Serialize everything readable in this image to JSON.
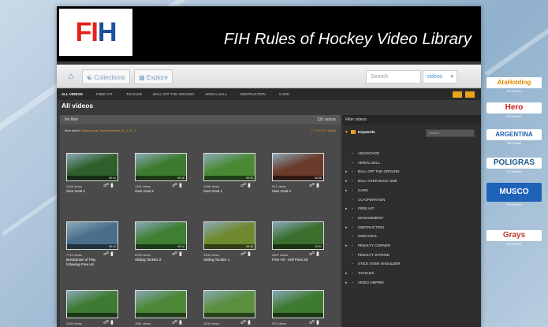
{
  "banner": {
    "logo_text": "FIH",
    "title": "FIH Rules of Hockey Video Library"
  },
  "nav": {
    "home_icon": "home-icon",
    "collections_label": "Collections",
    "explore_label": "Explore",
    "search_placeholder": "Search",
    "scope_value": "videos"
  },
  "tabs": [
    {
      "label": "All videos",
      "active": true
    },
    {
      "label": "FREE HIT"
    },
    {
      "label": "TACKLES"
    },
    {
      "label": "BALL OFF THE GROUND"
    },
    {
      "label": "AERIAL BALL"
    },
    {
      "label": "OBSTRUCTION"
    },
    {
      "label": "CARD"
    }
  ],
  "page_title": "All videos",
  "main": {
    "filter_label": "No filter",
    "count_label": "130 videos",
    "sort_label": "Most recent",
    "sort_options": "| Most popular | Most discussed | A - Z | Z - A",
    "pager": "1 2 3 4 5 6 7 8 Next"
  },
  "videos": [
    {
      "views": "1545 views",
      "title": "Own Goal 4",
      "duration": "00:14",
      "accent": "#2f5f2a"
    },
    {
      "views": "1261 views",
      "title": "Own Goal 2",
      "duration": "00:18",
      "accent": "#3d7a2e"
    },
    {
      "views": "1096 views",
      "title": "Own Goal 1",
      "duration": "00:20",
      "accent": "#4a8a35"
    },
    {
      "views": "971 views",
      "title": "Own Goal 3",
      "duration": "00:25",
      "accent": "#6a3a2a"
    },
    {
      "views": "7710 views",
      "title": "Breakdown of Play following Free Hit",
      "duration": "00:12",
      "accent": "#4b6f8a"
    },
    {
      "views": "5093 views",
      "title": "Sliding Tackles 2",
      "duration": "00:14",
      "accent": "#3e7f33"
    },
    {
      "views": "3336 views",
      "title": "Sliding Tackles 1",
      "duration": "00:16",
      "accent": "#6f8a2e"
    },
    {
      "views": "2807 views",
      "title": "Free Hit - Self Pass 26",
      "duration": "00:11",
      "accent": "#3a6e2c"
    },
    {
      "views": "2403 views",
      "title": "",
      "duration": "",
      "accent": "#3f7a33"
    },
    {
      "views": "1951 views",
      "title": "",
      "duration": "",
      "accent": "#4c8838"
    },
    {
      "views": "1030 views",
      "title": "",
      "duration": "",
      "accent": "#5a8f3d"
    },
    {
      "views": "972 views",
      "title": "",
      "duration": "",
      "accent": "#3e7a30"
    }
  ],
  "sidebar": {
    "title": "Filter videos",
    "keywords_label": "Keywords",
    "search_placeholder": "Search...",
    "keywords": [
      {
        "label": "ADVANTAGE",
        "expandable": false
      },
      {
        "label": "AERIAL BALL",
        "expandable": false
      },
      {
        "label": "BALL OFF THE GROUND",
        "expandable": true
      },
      {
        "label": "BALL OVER BACK LINE",
        "expandable": true
      },
      {
        "label": "CARD",
        "expandable": true
      },
      {
        "label": "CO-OPERATION",
        "expandable": false
      },
      {
        "label": "FREE HIT",
        "expandable": true
      },
      {
        "label": "MANAGEMENT",
        "expandable": false
      },
      {
        "label": "OBSTRUCTION",
        "expandable": true
      },
      {
        "label": "OWN GOAL",
        "expandable": false
      },
      {
        "label": "PENALTY CORNER",
        "expandable": true
      },
      {
        "label": "PENALTY STROKE",
        "expandable": false
      },
      {
        "label": "STICK OVER SHOULDER",
        "expandable": false
      },
      {
        "label": "TACKLES",
        "expandable": true
      },
      {
        "label": "VIDEO UMPIRE",
        "expandable": true
      }
    ]
  },
  "sponsors": [
    {
      "name": "AtaHolding",
      "caption": "FIH Partner",
      "bg": "#ffffff",
      "fg": "#e08a00"
    },
    {
      "name": "Hero",
      "caption": "FIH Partner",
      "bg": "#ffffff",
      "fg": "#d01a1a"
    },
    {
      "name": "ARGENTINA",
      "caption": "FIH Partner",
      "bg": "#ffffff",
      "fg": "#1c63b0"
    },
    {
      "name": "POLIGRAS",
      "caption": "FIH Partner",
      "bg": "#ffffff",
      "fg": "#1c5a8a"
    },
    {
      "name": "MUSCO",
      "caption": "FIH Partner",
      "bg": "#1f62b8",
      "fg": "#ffffff"
    },
    {
      "name": "Grays",
      "caption": "FIH Partner",
      "bg": "#ffffff",
      "fg": "#c0392b"
    }
  ],
  "colors": {
    "accent": "#e9a21e",
    "nav_blue": "#4a90c8"
  }
}
